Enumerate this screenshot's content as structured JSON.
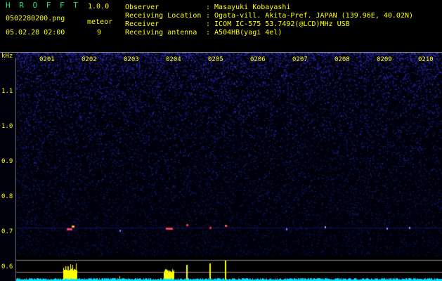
{
  "app": {
    "title": "H R O F F T",
    "version": "1.0.0"
  },
  "file": {
    "name": "0502280200.png",
    "datetime": "05.02.28 02:00"
  },
  "counter": {
    "label": "meteor",
    "value": "9"
  },
  "info": {
    "observer_label": "Observer",
    "observer_value": ": Masayuki Kobayashi",
    "location_label": "Receiving Location",
    "location_value": ": Ogata-vill. Akita-Pref. JAPAN (139.96E, 40.02N)",
    "receiver_label": "Receiver",
    "receiver_value": ": ICOM IC-575 53.7492(@LCD)MHz USB",
    "antenna_label": "Receiving antenna",
    "antenna_value": ": A504HB(yagi 4el)"
  },
  "y_axis": {
    "unit": "kHz",
    "ticks": [
      "1.1",
      "1.0",
      "0.9",
      "0.8",
      "0.7",
      "0.6"
    ]
  },
  "time_axis": {
    "ticks": [
      "0201",
      "0202",
      "0203",
      "0204",
      "0205",
      "0206",
      "0207",
      "0208",
      "0209",
      "0210"
    ]
  },
  "colors": {
    "label": "#ffff00",
    "title": "#20e070",
    "noise": "#2a2ad0",
    "meteor": "#ff3040",
    "spectrum_bar": "#ffff00",
    "baseline": "#00ffff"
  }
}
